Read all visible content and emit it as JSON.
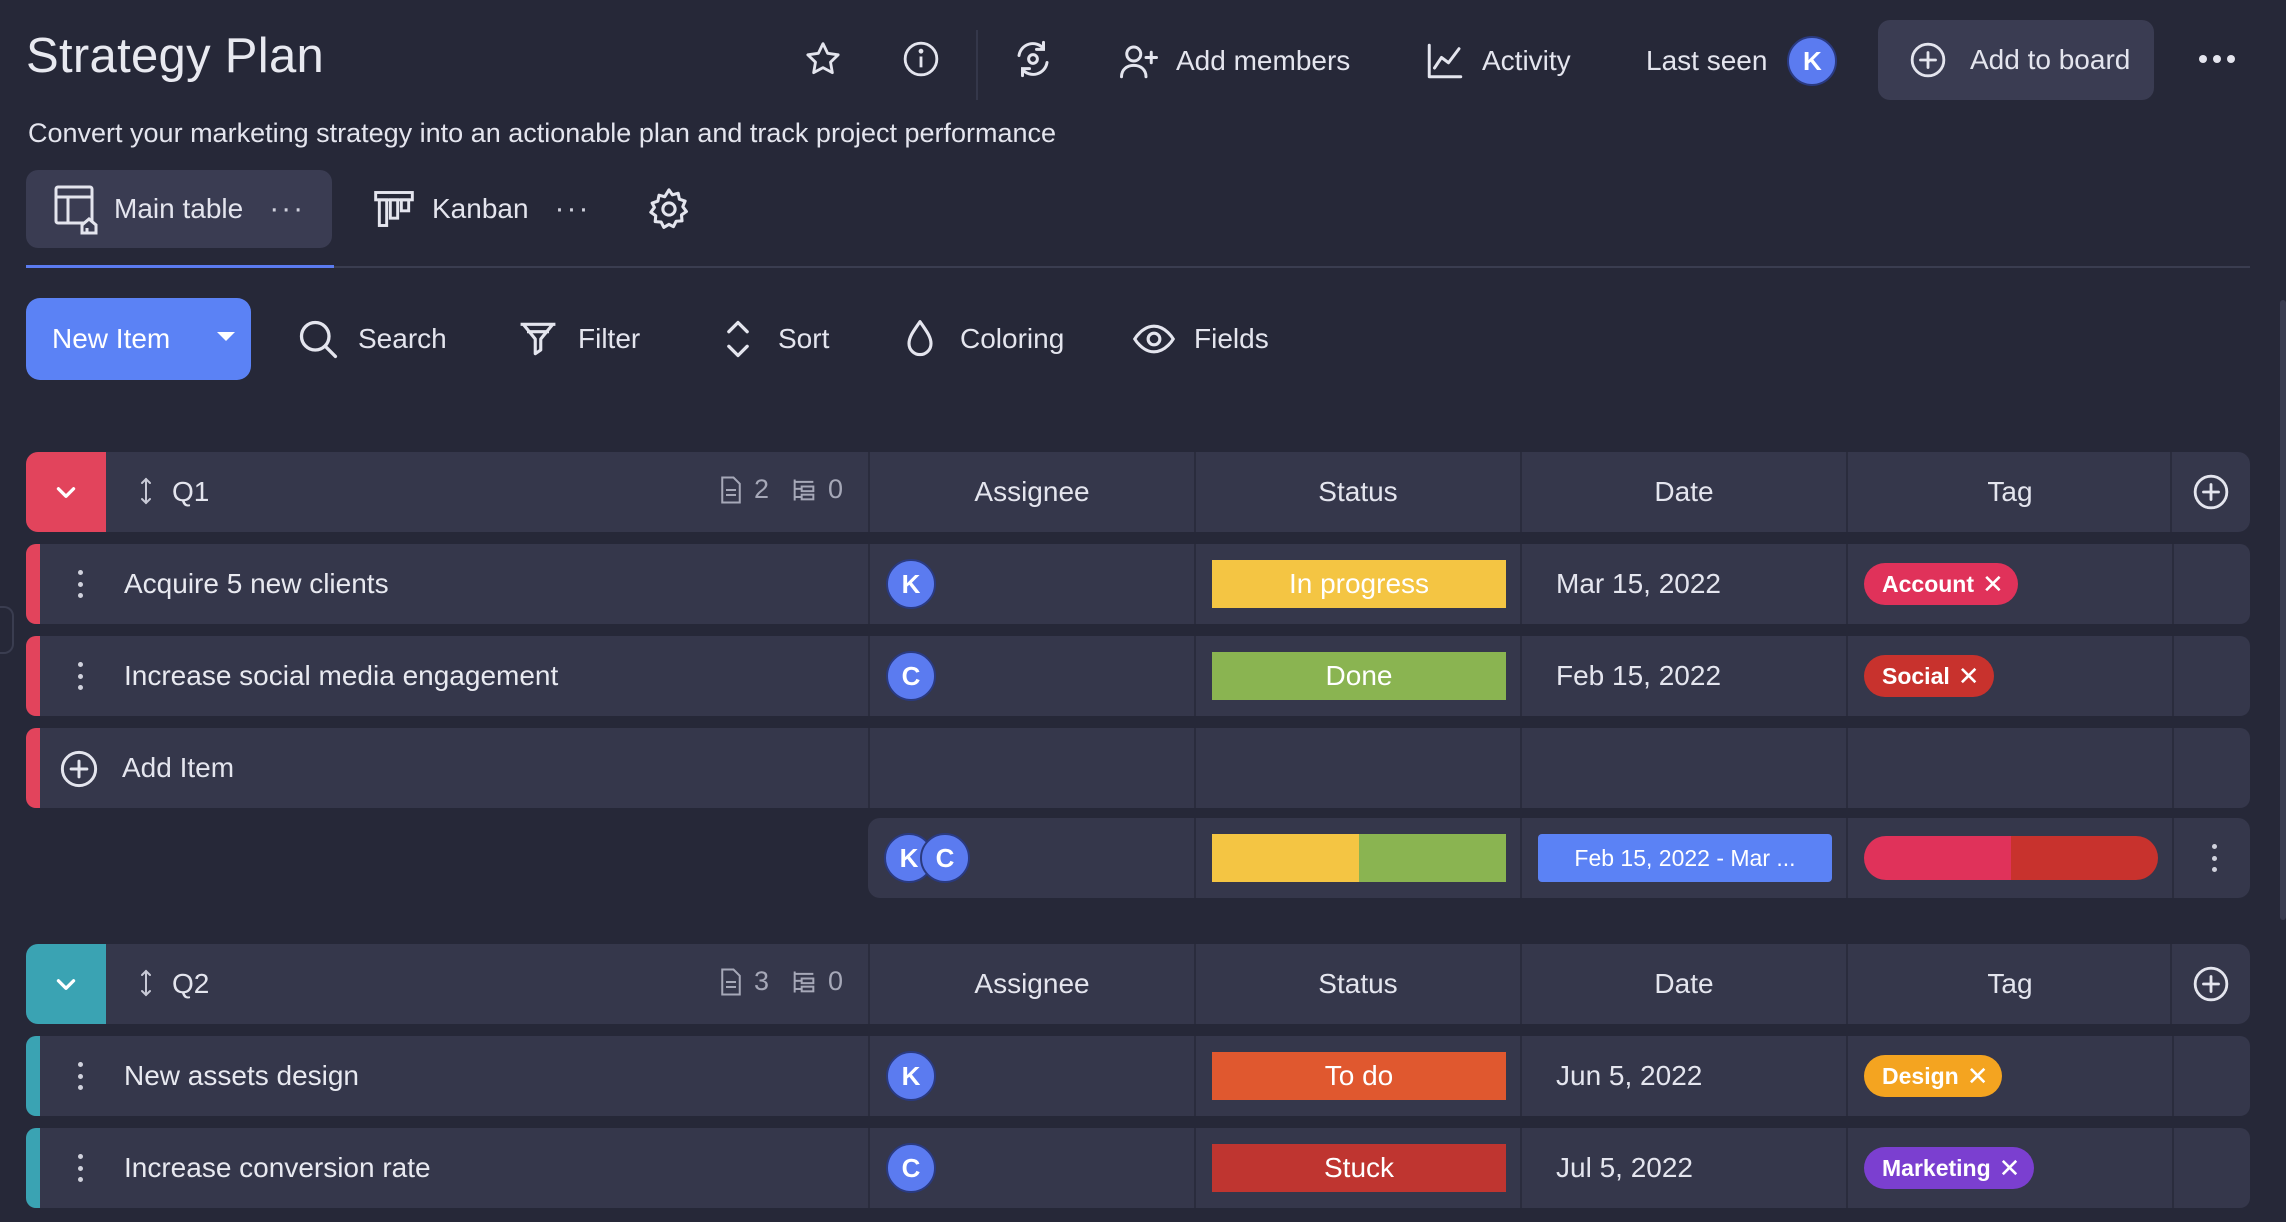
{
  "header": {
    "title": "Strategy Plan",
    "subtitle": "Convert your marketing strategy into an actionable plan and track project performance",
    "add_members": "Add members",
    "activity": "Activity",
    "last_seen": "Last seen",
    "last_seen_avatar": "K",
    "add_to_board": "Add to board",
    "icons": [
      "star-icon",
      "info-icon",
      "sync-icon",
      "add-user-icon",
      "activity-chart-icon",
      "add-circle-icon",
      "more-horizontal-icon"
    ]
  },
  "views": {
    "tabs": [
      {
        "label": "Main table",
        "active": true,
        "icon": "table-home-icon"
      },
      {
        "label": "Kanban",
        "active": false,
        "icon": "kanban-icon"
      }
    ],
    "more": "···"
  },
  "toolbar": {
    "new_item": "New Item",
    "search": "Search",
    "filter": "Filter",
    "sort": "Sort",
    "coloring": "Coloring",
    "fields": "Fields"
  },
  "columns": [
    "Assignee",
    "Status",
    "Date",
    "Tag"
  ],
  "add_item_label": "Add Item",
  "colors": {
    "accent": "#5b82f5",
    "q1": "#e2445c",
    "q2": "#3aa3b3",
    "in_progress": "#f4c543",
    "done": "#8ab451",
    "to_do": "#e0582f",
    "stuck": "#bf3530",
    "account": "#e0325a",
    "social": "#c8322d",
    "design": "#f4a420",
    "marketing": "#7b3fd0"
  },
  "groups": [
    {
      "name": "Q1",
      "color": "#e2445c",
      "items_count": "2",
      "subitems_count": "0",
      "rows": [
        {
          "name": "Acquire 5 new clients",
          "assignee": "K",
          "status": "In progress",
          "status_color": "#f4c543",
          "date": "Mar 15, 2022",
          "tag": "Account",
          "tag_color": "#e0325a"
        },
        {
          "name": "Increase social media engagement",
          "assignee": "C",
          "status": "Done",
          "status_color": "#8ab451",
          "date": "Feb 15, 2022",
          "tag": "Social",
          "tag_color": "#c8322d"
        }
      ],
      "summary": {
        "assignees": [
          "K",
          "C"
        ],
        "date_range": "Feb 15, 2022 - Mar ..."
      }
    },
    {
      "name": "Q2",
      "color": "#3aa3b3",
      "items_count": "3",
      "subitems_count": "0",
      "rows": [
        {
          "name": "New assets design",
          "assignee": "K",
          "status": "To do",
          "status_color": "#e0582f",
          "date": "Jun 5, 2022",
          "tag": "Design",
          "tag_color": "#f4a420"
        },
        {
          "name": "Increase conversion rate",
          "assignee": "C",
          "status": "Stuck",
          "status_color": "#bf3530",
          "date": "Jul 5, 2022",
          "tag": "Marketing",
          "tag_color": "#7b3fd0"
        }
      ]
    }
  ]
}
